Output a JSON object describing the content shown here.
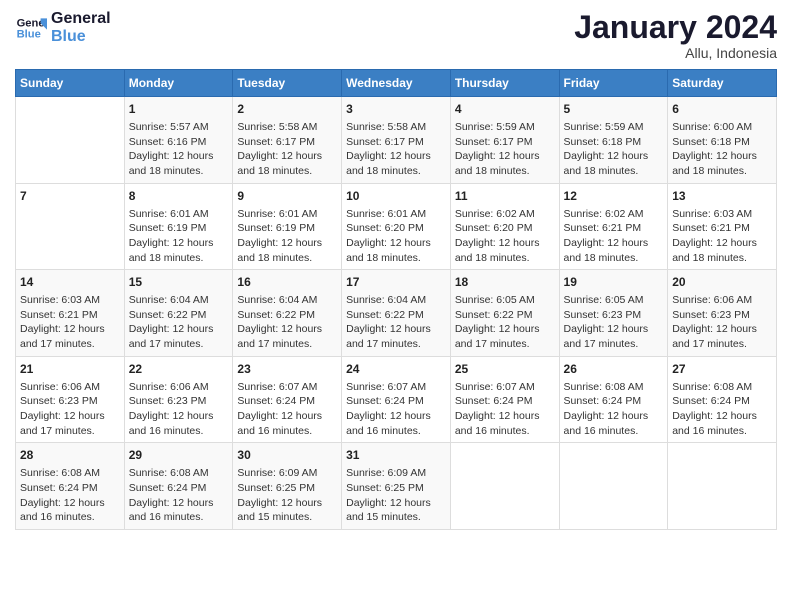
{
  "header": {
    "logo_line1": "General",
    "logo_line2": "Blue",
    "month": "January 2024",
    "location": "Allu, Indonesia"
  },
  "weekdays": [
    "Sunday",
    "Monday",
    "Tuesday",
    "Wednesday",
    "Thursday",
    "Friday",
    "Saturday"
  ],
  "weeks": [
    [
      {
        "day": "",
        "info": ""
      },
      {
        "day": "1",
        "info": "Sunrise: 5:57 AM\nSunset: 6:16 PM\nDaylight: 12 hours\nand 18 minutes."
      },
      {
        "day": "2",
        "info": "Sunrise: 5:58 AM\nSunset: 6:17 PM\nDaylight: 12 hours\nand 18 minutes."
      },
      {
        "day": "3",
        "info": "Sunrise: 5:58 AM\nSunset: 6:17 PM\nDaylight: 12 hours\nand 18 minutes."
      },
      {
        "day": "4",
        "info": "Sunrise: 5:59 AM\nSunset: 6:17 PM\nDaylight: 12 hours\nand 18 minutes."
      },
      {
        "day": "5",
        "info": "Sunrise: 5:59 AM\nSunset: 6:18 PM\nDaylight: 12 hours\nand 18 minutes."
      },
      {
        "day": "6",
        "info": "Sunrise: 6:00 AM\nSunset: 6:18 PM\nDaylight: 12 hours\nand 18 minutes."
      }
    ],
    [
      {
        "day": "7",
        "info": ""
      },
      {
        "day": "8",
        "info": "Sunrise: 6:01 AM\nSunset: 6:19 PM\nDaylight: 12 hours\nand 18 minutes."
      },
      {
        "day": "9",
        "info": "Sunrise: 6:01 AM\nSunset: 6:19 PM\nDaylight: 12 hours\nand 18 minutes."
      },
      {
        "day": "10",
        "info": "Sunrise: 6:01 AM\nSunset: 6:20 PM\nDaylight: 12 hours\nand 18 minutes."
      },
      {
        "day": "11",
        "info": "Sunrise: 6:02 AM\nSunset: 6:20 PM\nDaylight: 12 hours\nand 18 minutes."
      },
      {
        "day": "12",
        "info": "Sunrise: 6:02 AM\nSunset: 6:21 PM\nDaylight: 12 hours\nand 18 minutes."
      },
      {
        "day": "13",
        "info": "Sunrise: 6:03 AM\nSunset: 6:21 PM\nDaylight: 12 hours\nand 18 minutes."
      }
    ],
    [
      {
        "day": "14",
        "info": "Sunrise: 6:03 AM\nSunset: 6:21 PM\nDaylight: 12 hours\nand 17 minutes."
      },
      {
        "day": "15",
        "info": "Sunrise: 6:04 AM\nSunset: 6:22 PM\nDaylight: 12 hours\nand 17 minutes."
      },
      {
        "day": "16",
        "info": "Sunrise: 6:04 AM\nSunset: 6:22 PM\nDaylight: 12 hours\nand 17 minutes."
      },
      {
        "day": "17",
        "info": "Sunrise: 6:04 AM\nSunset: 6:22 PM\nDaylight: 12 hours\nand 17 minutes."
      },
      {
        "day": "18",
        "info": "Sunrise: 6:05 AM\nSunset: 6:22 PM\nDaylight: 12 hours\nand 17 minutes."
      },
      {
        "day": "19",
        "info": "Sunrise: 6:05 AM\nSunset: 6:23 PM\nDaylight: 12 hours\nand 17 minutes."
      },
      {
        "day": "20",
        "info": "Sunrise: 6:06 AM\nSunset: 6:23 PM\nDaylight: 12 hours\nand 17 minutes."
      }
    ],
    [
      {
        "day": "21",
        "info": "Sunrise: 6:06 AM\nSunset: 6:23 PM\nDaylight: 12 hours\nand 17 minutes."
      },
      {
        "day": "22",
        "info": "Sunrise: 6:06 AM\nSunset: 6:23 PM\nDaylight: 12 hours\nand 16 minutes."
      },
      {
        "day": "23",
        "info": "Sunrise: 6:07 AM\nSunset: 6:24 PM\nDaylight: 12 hours\nand 16 minutes."
      },
      {
        "day": "24",
        "info": "Sunrise: 6:07 AM\nSunset: 6:24 PM\nDaylight: 12 hours\nand 16 minutes."
      },
      {
        "day": "25",
        "info": "Sunrise: 6:07 AM\nSunset: 6:24 PM\nDaylight: 12 hours\nand 16 minutes."
      },
      {
        "day": "26",
        "info": "Sunrise: 6:08 AM\nSunset: 6:24 PM\nDaylight: 12 hours\nand 16 minutes."
      },
      {
        "day": "27",
        "info": "Sunrise: 6:08 AM\nSunset: 6:24 PM\nDaylight: 12 hours\nand 16 minutes."
      }
    ],
    [
      {
        "day": "28",
        "info": "Sunrise: 6:08 AM\nSunset: 6:24 PM\nDaylight: 12 hours\nand 16 minutes."
      },
      {
        "day": "29",
        "info": "Sunrise: 6:08 AM\nSunset: 6:24 PM\nDaylight: 12 hours\nand 16 minutes."
      },
      {
        "day": "30",
        "info": "Sunrise: 6:09 AM\nSunset: 6:25 PM\nDaylight: 12 hours\nand 15 minutes."
      },
      {
        "day": "31",
        "info": "Sunrise: 6:09 AM\nSunset: 6:25 PM\nDaylight: 12 hours\nand 15 minutes."
      },
      {
        "day": "",
        "info": ""
      },
      {
        "day": "",
        "info": ""
      },
      {
        "day": "",
        "info": ""
      }
    ]
  ]
}
